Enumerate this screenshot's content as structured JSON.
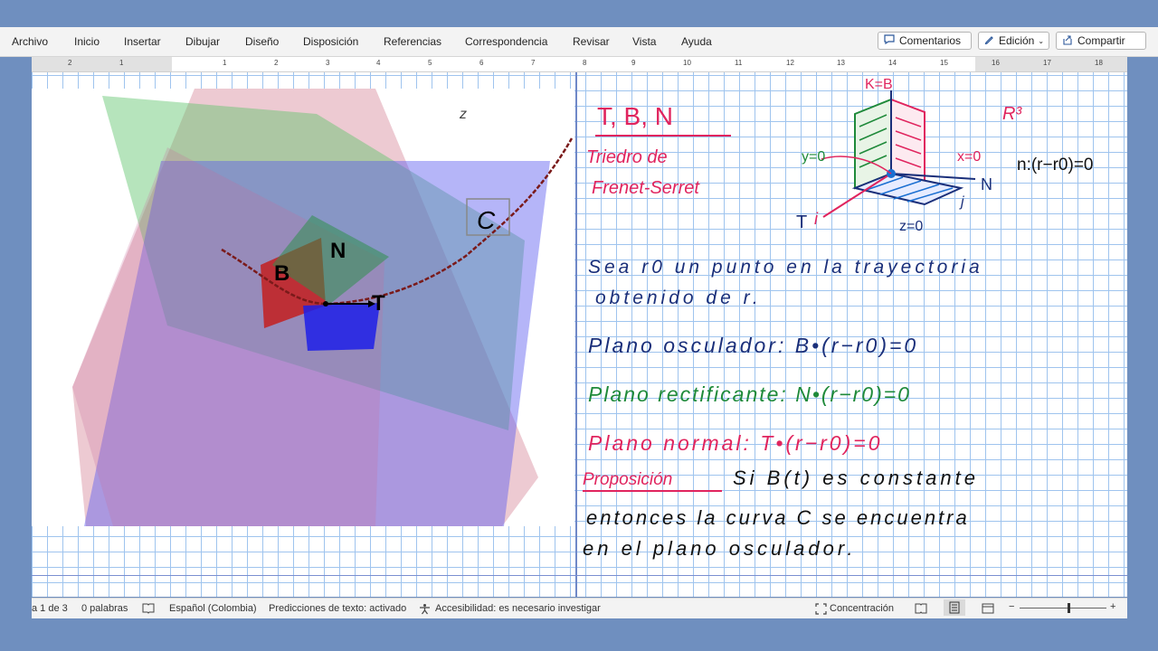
{
  "ribbon": {
    "menu": [
      "Archivo",
      "Inicio",
      "Insertar",
      "Dibujar",
      "Diseño",
      "Disposición",
      "Referencias",
      "Correspondencia",
      "Revisar",
      "Vista",
      "Ayuda"
    ],
    "comments_label": "Comentarios",
    "editing_label": "Edición",
    "share_label": "Compartir"
  },
  "ruler": {
    "numbers": [
      "2",
      "1",
      "1",
      "2",
      "3",
      "4",
      "5",
      "6",
      "7",
      "8",
      "9",
      "10",
      "11",
      "12",
      "13",
      "14",
      "15",
      "16",
      "17",
      "18"
    ]
  },
  "figure": {
    "label_z": "z",
    "label_C": "C",
    "label_N": "N",
    "label_B": "B",
    "label_T": "T"
  },
  "notes": {
    "title": "T, B, N",
    "subtitle_1": "Triedro de",
    "subtitle_2": "Frenet-Serret",
    "diagram_KB": "K=B",
    "diagram_R3": "R³",
    "diagram_y0": "y=0",
    "diagram_x0": "x=0",
    "diagram_N": "N",
    "diagram_T": "T",
    "diagram_i": "i",
    "diagram_z0": "z=0",
    "diagram_j": "j",
    "plane_eq": "n:(r−r0)=0",
    "line1": "Sea r0 un punto en la trayectoria",
    "line2": "obtenido de r.",
    "osculador": "Plano osculador: B•(r−r0)=0",
    "rectificante": "Plano rectificante: N•(r−r0)=0",
    "normal": "Plano normal: T•(r−r0)=0",
    "prop_label": "Proposición",
    "prop_1": "Si B(t) es constante",
    "prop_2": "entonces la curva C se encuentra",
    "prop_3": "en el plano osculador."
  },
  "status": {
    "page": "a 1 de 3",
    "words": "0 palabras",
    "language": "Español (Colombia)",
    "predictions": "Predicciones de texto: activado",
    "accessibility": "Accesibilidad: es necesario investigar",
    "focus": "Concentración",
    "zoom_minus": "−",
    "zoom_plus": "+"
  },
  "colors": {
    "pink": "#e0245e",
    "green": "#1f8a3a",
    "navy": "#1a2f7a",
    "black": "#111111"
  }
}
